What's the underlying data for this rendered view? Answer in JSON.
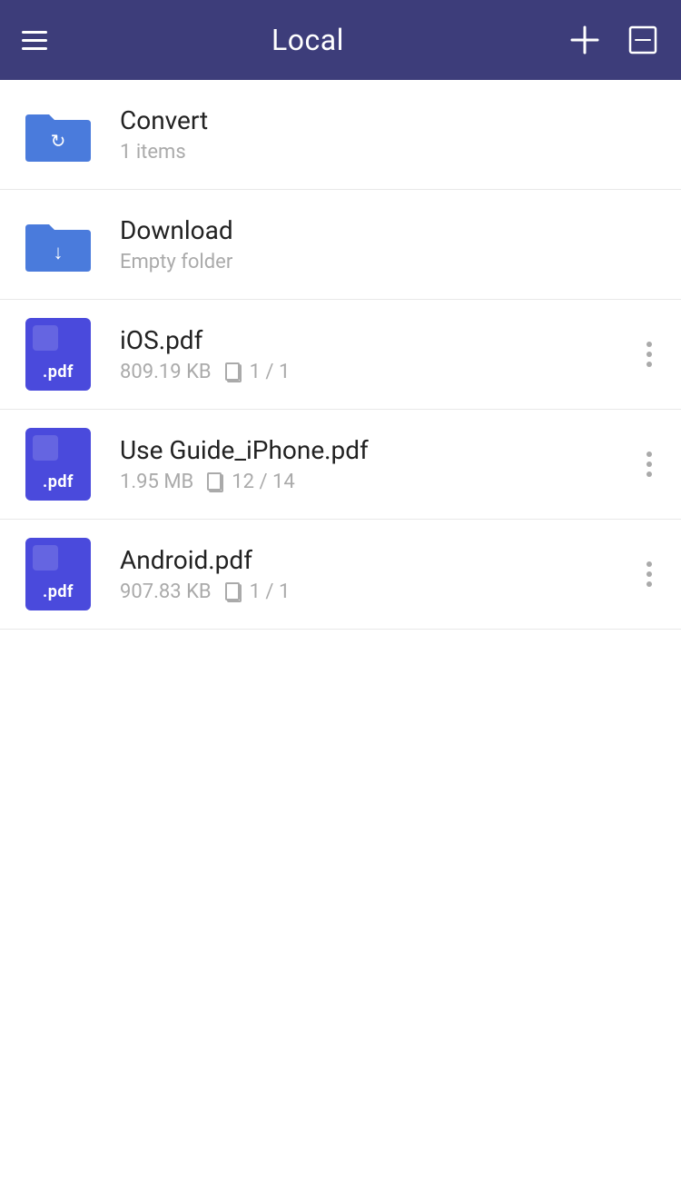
{
  "header": {
    "title": "Local",
    "menu_icon": "hamburger-icon",
    "add_icon": "plus-icon",
    "edit_icon": "edit-icon"
  },
  "items": [
    {
      "id": "convert",
      "type": "folder",
      "name": "Convert",
      "meta": "1 items",
      "has_menu": false,
      "folder_type": "convert"
    },
    {
      "id": "download",
      "type": "folder",
      "name": "Download",
      "meta": "Empty folder",
      "has_menu": false,
      "folder_type": "download"
    },
    {
      "id": "ios-pdf",
      "type": "pdf",
      "name": "iOS.pdf",
      "size": "809.19 KB",
      "pages": "1 / 1",
      "has_menu": true
    },
    {
      "id": "use-guide-pdf",
      "type": "pdf",
      "name": "Use Guide_iPhone.pdf",
      "size": "1.95 MB",
      "pages": "12 / 14",
      "has_menu": true
    },
    {
      "id": "android-pdf",
      "type": "pdf",
      "name": "Android.pdf",
      "size": "907.83 KB",
      "pages": "1 / 1",
      "has_menu": true
    }
  ],
  "colors": {
    "header_bg": "#3d3d7a",
    "folder_bg": "#4a7bdc",
    "pdf_bg": "#4a4adc",
    "text_primary": "#222222",
    "text_secondary": "#aaaaaa"
  }
}
